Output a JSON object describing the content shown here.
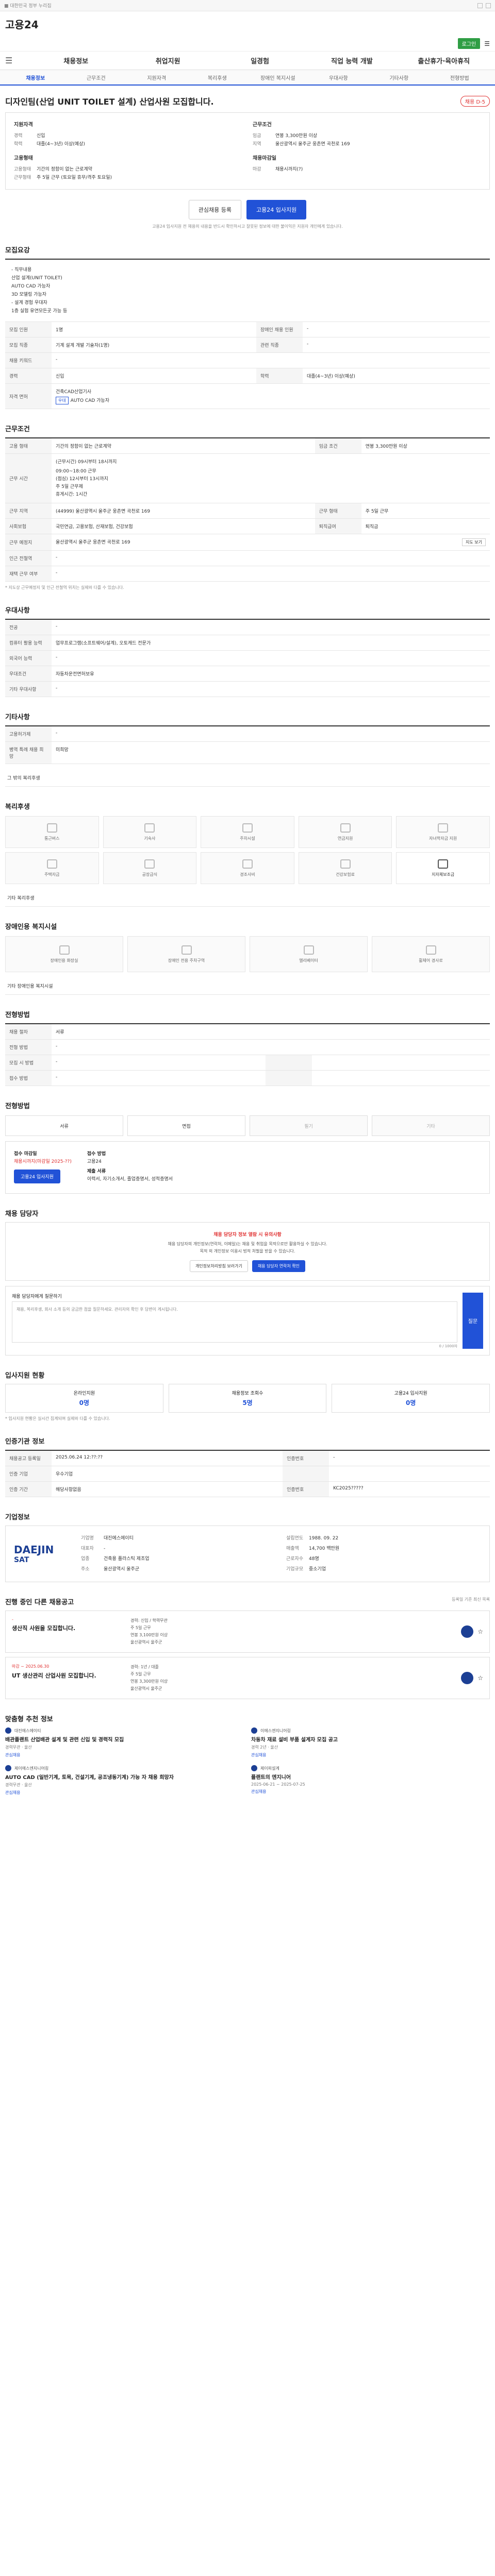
{
  "site": {
    "logo_main": "고용",
    "logo_sub": "24",
    "login": "로그인"
  },
  "gnb": [
    "채용정보",
    "취업지원",
    "일경험",
    "직업 능력 개발",
    "출산휴가·육아휴직"
  ],
  "subnav": [
    "채용정보",
    "근무조건",
    "지원자격",
    "복리후생",
    "장애인 복지시설",
    "우대사항",
    "기타사항",
    "전형방법"
  ],
  "title": "디자인팀(산업 UNIT TOILET 설계) 산업사원 모집합니다.",
  "title_badge": "채용 D-5",
  "summary": {
    "left_h": "지원자격",
    "left": [
      {
        "k": "경력",
        "v": "신입"
      },
      {
        "k": "학력",
        "v": "대졸(4~3년) 이상(예상)"
      }
    ],
    "left_h2": "고용형태",
    "left2": [
      {
        "k": "고용형태",
        "v": "기간의 정함이 없는 근로계약"
      },
      {
        "k": "근무형태",
        "v": "주 5일 근무 (토요일 휴무/격주 토요일)"
      }
    ],
    "right_h": "근무조건",
    "right": [
      {
        "k": "임금",
        "v": "연봉 3,300만원 이상"
      },
      {
        "k": "지역",
        "v": "울산광역시 울주군 웅촌면 곡천로 169"
      }
    ],
    "right_h2": "채용마감일",
    "right2": [
      {
        "k": "마감",
        "v": "채용시까지(?)"
      }
    ]
  },
  "actions": {
    "save": "관심채용 등록",
    "apply": "고용24 입사지원"
  },
  "notice": "고용24 입사지원 전 채용의 내용을 반드시 확인하시고 잘못된 정보에 대한 불이익은 지원자 개인에게 있습니다.",
  "duty": {
    "h": "모집요강",
    "lines": [
      "- 직무내용",
      "산업 설계(UNIT TOILET)",
      "AUTO CAD 가능자",
      "3D 모델링 가능자",
      "- 설계 경험 우대자",
      "1층 실험 유연모든곳 가능 등"
    ],
    "rows": [
      {
        "k": "모집 인원",
        "v": "1명",
        "k2": "장애인 채용 인원",
        "v2": "-"
      },
      {
        "k": "모집 직종",
        "v": "기계 설계 개발 기술자(1명)",
        "k2": "관련 직종",
        "v2": "-"
      },
      {
        "k": "채용 키워드",
        "v": "-",
        "k2": "",
        "v2": ""
      },
      {
        "k": "경력",
        "v": "신입",
        "k2": "학력",
        "v2": "대졸(4~3년) 이상(예상)"
      },
      {
        "k": "자격 면허",
        "v": "건축CAD산업기사",
        "k2": "",
        "v2": ""
      }
    ],
    "tags": [
      "우대",
      "AUTO CAD 가능자"
    ]
  },
  "work": {
    "h": "근무조건",
    "rows": [
      {
        "k": "고용 형태",
        "v": "기간의 정함이 없는 근로계약",
        "k2": "임금 조건",
        "v2": "연봉 3,300만원 이상"
      },
      {
        "k": "근무 시간",
        "v": "(근무시간) 09시부터 18시까지"
      },
      {
        "k": "근무 지역",
        "v": "(44999) 울산광역시 울주군 웅촌면 곡천로 169",
        "k2": "근무 형태",
        "v2": "주 5일 근무"
      },
      {
        "k": "사회보험",
        "v": "국민연금, 고용보험, 산재보험, 건강보험",
        "k2": "퇴직급여",
        "v2": "퇴직금"
      },
      {
        "k": "근무 예정지",
        "v": "울산광역시 울주군 웅촌면 곡천로 169",
        "k2": "",
        "v2": ""
      },
      {
        "k": "인근 전철역",
        "v": "-",
        "k2": "",
        "v2": ""
      },
      {
        "k": "재택 근무 여부",
        "v": "-",
        "k2": "",
        "v2": ""
      }
    ],
    "time_lines": [
      "09:00~18:00 근무",
      "(점심) 12시부터 13시까지",
      "주 5일 근무제",
      "휴게시간: 1시간"
    ],
    "note": "* 지도상 근무예정지 및 인근 전철역 위치는 실제와 다를 수 있습니다.",
    "map_btn": "지도 보기"
  },
  "pref": {
    "h": "우대사항",
    "rows": [
      {
        "k": "전공",
        "v": "-"
      },
      {
        "k": "컴퓨터 활용 능력",
        "v": "업무프로그램(소프트웨어/설계), 오토캐드 전문가"
      },
      {
        "k": "외국어 능력",
        "v": "-"
      },
      {
        "k": "우대조건",
        "v": "자동차운전면허보유"
      },
      {
        "k": "기타 우대사항",
        "v": "-"
      }
    ]
  },
  "etc": {
    "h": "기타사항",
    "rows": [
      {
        "k": "고용허가제",
        "v": "-"
      },
      {
        "k": "병역 특례 채용 희망",
        "v": "미희망"
      }
    ],
    "extra": "그 밖의 복리후생"
  },
  "welfare": {
    "h": "복리후생",
    "items": [
      "통근버스",
      "기숙사",
      "주차시설",
      "연금지원",
      "자녀학자금 지원",
      "주택자금",
      "공장급식",
      "경조사비",
      "건강보험료",
      "지자체보조금"
    ],
    "on_index": 9,
    "line": "기타 복리후생"
  },
  "disability": {
    "h": "장애인용 복지시설",
    "items": [
      "장애인용 화장실",
      "장애인 전용 주차구역",
      "엘리베이터",
      "휠체어 경사로"
    ],
    "line": "기타 장애인용 복지시설"
  },
  "method": {
    "h": "전형방법",
    "rows": [
      {
        "k": "채용 절차",
        "v": "서류"
      },
      {
        "k": "전형 방법",
        "v": "-"
      },
      {
        "k": "모집 시 방법",
        "v": "-",
        "k2": "",
        "v2": ""
      },
      {
        "k": "접수 방법",
        "v": "-",
        "k2": "",
        "v2": ""
      }
    ]
  },
  "process": {
    "h": "전형방법",
    "options": [
      "서류",
      "면접",
      "필기",
      "기타"
    ],
    "on": [
      0,
      1
    ]
  },
  "apply": {
    "h1": "접수 마감일",
    "v1": "채용시까지(마감일 2025-??)",
    "h2": "접수 방법",
    "v2": "고용24",
    "h3": "제출 서류",
    "v3": "이력서, 자기소개서, 졸업증명서, 성적증명서",
    "btn": "고용24 입사지원"
  },
  "contact": {
    "h": "채용 담당자",
    "warn": "채용 담당자 정보 열람 시 유의사항",
    "msg1": "채용 담당자의 개인정보(연락처, 이메일)는 채용 및 취업을 목적으로만 활용하실 수 있습니다.",
    "msg2": "목적 외 개인정보 이용시 법적 처벌을 받을 수 있습니다.",
    "btn1": "개인정보처리방침 보러가기",
    "btn2": "채용 담당자 연락처 확인",
    "qa_label": "채용 담당자에게 질문하기",
    "qa_placeholder": "채용, 복리후생, 회사 소개 등의 궁금한 점을 질문하세요. 관리자의 확인 후 답변이 게시됩니다.",
    "qa_btn": "질문",
    "qa_count": "0 / 1000자"
  },
  "stats": {
    "h": "입사지원 현황",
    "items": [
      {
        "label": "온라인지원",
        "n": "0명"
      },
      {
        "label": "채용정보 조회수",
        "n": "5명"
      },
      {
        "label": "고용24 입사지원",
        "n": "0명"
      }
    ],
    "note": "* 입사지원 현황은 실시간 집계되며 실제와 다를 수 있습니다."
  },
  "auth": {
    "h": "인증기관 정보",
    "rows": [
      {
        "k": "채용공고 등록일",
        "v": "2025.06.24 12:??:??",
        "k2": "인증번호",
        "v2": "-"
      },
      {
        "k": "인증 기업",
        "v": "우수기업",
        "k2": "",
        "v2": ""
      },
      {
        "k": "인증 기간",
        "v": "해당사항없음",
        "k2": "인증번호",
        "v2": "KC2025?????"
      }
    ]
  },
  "company": {
    "h": "기업정보",
    "logo": "DAEJIN",
    "logo2": "SAT",
    "rows": [
      {
        "k": "기업명",
        "v": "대진에스에이티"
      },
      {
        "k": "대표자",
        "v": "-"
      },
      {
        "k": "업종",
        "v": "건축용 플라스틱 제조업"
      },
      {
        "k": "주소",
        "v": "울산광역시 울주군"
      },
      {
        "k": "설립연도",
        "v": "1988. 09. 22"
      },
      {
        "k": "매출액",
        "v": "14,700 백만원"
      },
      {
        "k": "근로자수",
        "v": "48명"
      },
      {
        "k": "기업규모",
        "v": "중소기업"
      }
    ]
  },
  "plist": {
    "h": "진행 중인 다른 채용공고",
    "note": "등록일 기준 최신 목록",
    "cards": [
      {
        "d": "-",
        "t": "생산직 사원을 모집합니다.",
        "l1": "경력: 신입 / 학력무관",
        "l2": "주 5일 근무",
        "l3": "연봉 3,100만원 이상",
        "l4": "울산광역시 울주군"
      },
      {
        "d": "마감 ~ 2025.06.30",
        "t": "UT 생산관리 산업사원 모집합니다.",
        "l1": "경력: 1년 / 대졸",
        "l2": "주 5일 근무",
        "l3": "연봉 3,300만원 이상",
        "l4": "울산광역시 울주군"
      }
    ]
  },
  "recommend": {
    "h": "맞춤형 추천 정보",
    "cards": [
      {
        "co": "대진에스에이티",
        "t": "배관플랜트 산업배관 설계 및 관련 신입 및 경력직 모집",
        "m": "경력무관 · 울산",
        "a": "관심채용"
      },
      {
        "co": "이에스엔지니어링",
        "t": "차동차 재료 설비 부품 설계자 모집 공고",
        "m": "경력 2년 · 울산",
        "a": "관심채용"
      },
      {
        "co": "제이에스엔지니어링",
        "t": "AUTO CAD (일반기계, 토목, 건설기계, 공조냉동기계) 가능 자 채용 희망자",
        "m": "경력무관 · 울산",
        "a": "관심채용"
      },
      {
        "co": "제이피설계",
        "t": "플랜트의 엔지니어",
        "m": "2025-06-21 ~ 2025-07-25",
        "a": "관심채용"
      }
    ]
  }
}
